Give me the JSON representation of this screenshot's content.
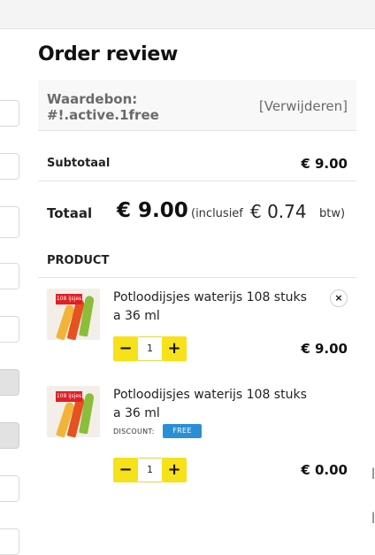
{
  "page": {
    "title": "Order review"
  },
  "coupon": {
    "code": "Waardebon: #!.active.1free",
    "code_line1": "Waardebon:",
    "code_line2": "#!.active.1free",
    "remove_label": "[Verwijderen]"
  },
  "subtotal": {
    "label": "Subtotaal",
    "value": "€ 9.00"
  },
  "total": {
    "label": "Totaal",
    "value": "€ 9.00",
    "incl_label": "(inclusief",
    "tax_value": "€ 0.74",
    "tax_suffix": "btw)"
  },
  "products": {
    "header": "PRODUCT",
    "items": [
      {
        "name_line1": "Potloodijsjes waterijs 108 stuks",
        "name_line2": "a 36 ml",
        "qty": "1",
        "price": "€ 9.00",
        "thumb_tag": "108 ijsjes",
        "remove_icon": "×"
      },
      {
        "name_line1": "Potloodijsjes waterijs 108 stuks",
        "name_line2": "a 36 ml",
        "qty": "1",
        "price": "€ 0.00",
        "thumb_tag": "108 ijsjes",
        "discount_label": "DISCOUNT:",
        "discount_badge": "FREE"
      }
    ],
    "qty_minus": "−",
    "qty_plus": "+"
  },
  "colors": {
    "accent_yellow": "#f6e11a",
    "badge_blue": "#2b8fd6"
  }
}
